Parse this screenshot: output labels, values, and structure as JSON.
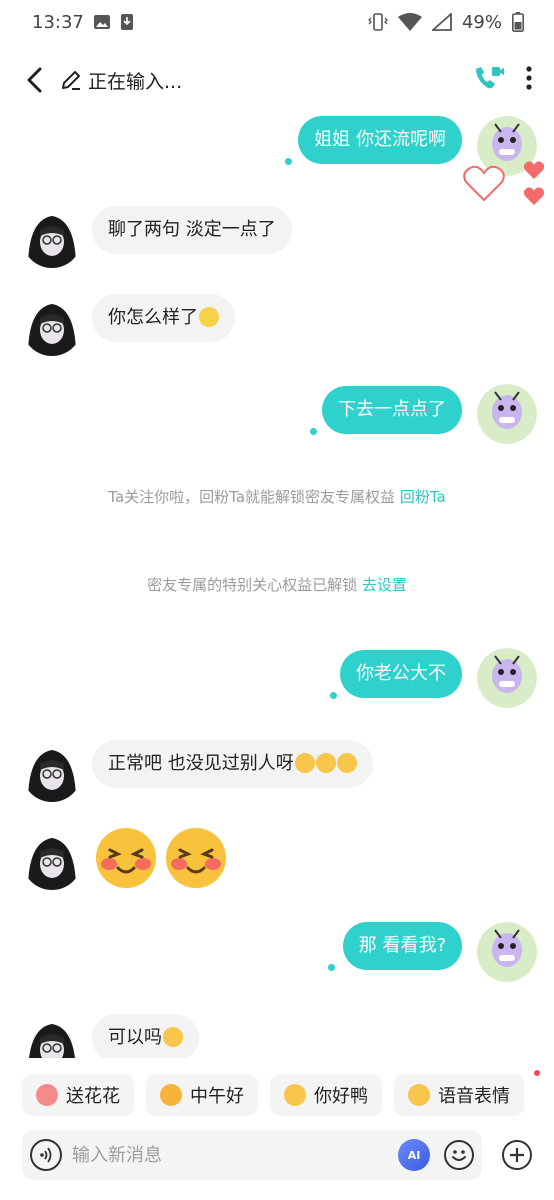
{
  "status_bar": {
    "time": "13:37",
    "battery": "49%"
  },
  "header": {
    "typing_status": "正在输入..."
  },
  "messages": [
    {
      "side": "out",
      "text": "姐姐 你还流呢啊"
    },
    {
      "side": "in",
      "text": "聊了两句 淡定一点了"
    },
    {
      "side": "in",
      "text": "你怎么样了"
    },
    {
      "side": "out",
      "text": "下去一点点了"
    },
    {
      "side": "out",
      "text": "你老公大不"
    },
    {
      "side": "in",
      "text": "正常吧 也没见过别人呀"
    },
    {
      "side": "out",
      "text": "那 看看我?"
    },
    {
      "side": "in",
      "text": "可以吗"
    }
  ],
  "system_notices": [
    {
      "text": "Ta关注你啦，回粉Ta就能解锁密友专属权益 ",
      "link": "回粉Ta"
    },
    {
      "text": "密友专属的特别关心权益已解锁 ",
      "link": "去设置"
    }
  ],
  "quick_replies": [
    {
      "label": "送花花",
      "icon": "flower-emoji"
    },
    {
      "label": "中午好",
      "icon": "sunglasses-emoji"
    },
    {
      "label": "你好鸭",
      "icon": "tongue-emoji"
    },
    {
      "label": "语音表情",
      "icon": "wink-emoji"
    }
  ],
  "input": {
    "placeholder": "输入新消息",
    "value": "",
    "ai_label": "AI"
  },
  "colors": {
    "accent": "#2fd1cc",
    "link": "#2fc6c2",
    "incoming_bubble": "#f3f3f3",
    "heart": "#f26a6a"
  }
}
